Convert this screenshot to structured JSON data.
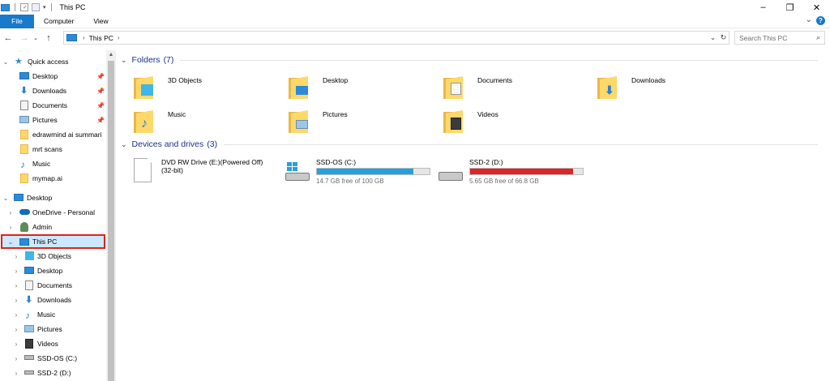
{
  "window": {
    "title": "This PC"
  },
  "ribbon": {
    "tabs": [
      "File",
      "Computer",
      "View"
    ]
  },
  "address": {
    "crumb": "This PC",
    "search_placeholder": "Search This PC"
  },
  "sidebar": {
    "quick_access": "Quick access",
    "quick_items": [
      {
        "label": "Desktop",
        "pinned": true
      },
      {
        "label": "Downloads",
        "pinned": true
      },
      {
        "label": "Documents",
        "pinned": true
      },
      {
        "label": "Pictures",
        "pinned": true
      },
      {
        "label": "edrawmind ai summari",
        "pinned": false
      },
      {
        "label": "mrt scans",
        "pinned": false
      },
      {
        "label": "Music",
        "pinned": false
      },
      {
        "label": "mymap.ai",
        "pinned": false
      }
    ],
    "desktop": "Desktop",
    "desktop_items": [
      "OneDrive - Personal",
      "Admin",
      "This PC"
    ],
    "pc_items": [
      "3D Objects",
      "Desktop",
      "Documents",
      "Downloads",
      "Music",
      "Pictures",
      "Videos",
      "SSD-OS (C:)",
      "SSD-2 (D:)"
    ]
  },
  "content": {
    "folders_header": "Folders",
    "folders_count": "(7)",
    "folders": [
      "3D Objects",
      "Desktop",
      "Documents",
      "Downloads",
      "Music",
      "Pictures",
      "Videos"
    ],
    "drives_header": "Devices and drives",
    "drives_count": "(3)",
    "dvd": {
      "name": "DVD RW Drive (E:)(Powered Off)",
      "sub": "(32-bit)"
    },
    "drives": [
      {
        "name": "SSD-OS (C:)",
        "free": "14.7 GB free of 100 GB",
        "used_fraction": 0.853,
        "color": "#26a0da"
      },
      {
        "name": "SSD-2 (D:)",
        "free": "5.65 GB free of 66.8 GB",
        "used_fraction": 0.915,
        "color": "#da2626"
      }
    ]
  },
  "colors": {
    "accent": "#1979ca",
    "selection": "#cce8ff",
    "highlight_border": "#e0221b",
    "group_header": "#1e3287"
  }
}
